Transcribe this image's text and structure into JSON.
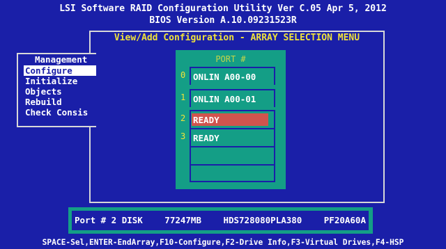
{
  "header": {
    "line1": "LSI Software RAID Configuration Utility Ver C.05 Apr 5, 2012",
    "line2": "BIOS Version   A.10.09231523R"
  },
  "menu_title": "View/Add Configuration - ARRAY SELECTION MENU",
  "management": {
    "title": "Management",
    "items": [
      {
        "label": "Configure",
        "selected": true
      },
      {
        "label": "Initialize",
        "selected": false
      },
      {
        "label": "Objects",
        "selected": false
      },
      {
        "label": "Rebuild",
        "selected": false
      },
      {
        "label": "Check Consis",
        "selected": false
      }
    ]
  },
  "port_panel": {
    "title": "PORT #",
    "rows": [
      {
        "index": "0",
        "text": "ONLIN A00-00"
      },
      {
        "index": "1",
        "text": "ONLIN A00-01"
      },
      {
        "index": "2",
        "text": "READY"
      },
      {
        "index": "3",
        "text": "READY"
      },
      {
        "index": "",
        "text": ""
      },
      {
        "index": "",
        "text": ""
      }
    ]
  },
  "info_bar": {
    "port": "Port # 2 DISK",
    "size": "77247MB",
    "model": "HDS728080PLA380",
    "firmware": "PF20A60A"
  },
  "footer": "SPACE-Sel,ENTER-EndArray,F10-Configure,F2-Drive Info,F3-Virtual Drives,F4-HSP",
  "colors": {
    "background": "#1a1fa8",
    "panel": "#149e86",
    "highlight": "#d0544e",
    "title_yellow": "#f0e23a"
  }
}
